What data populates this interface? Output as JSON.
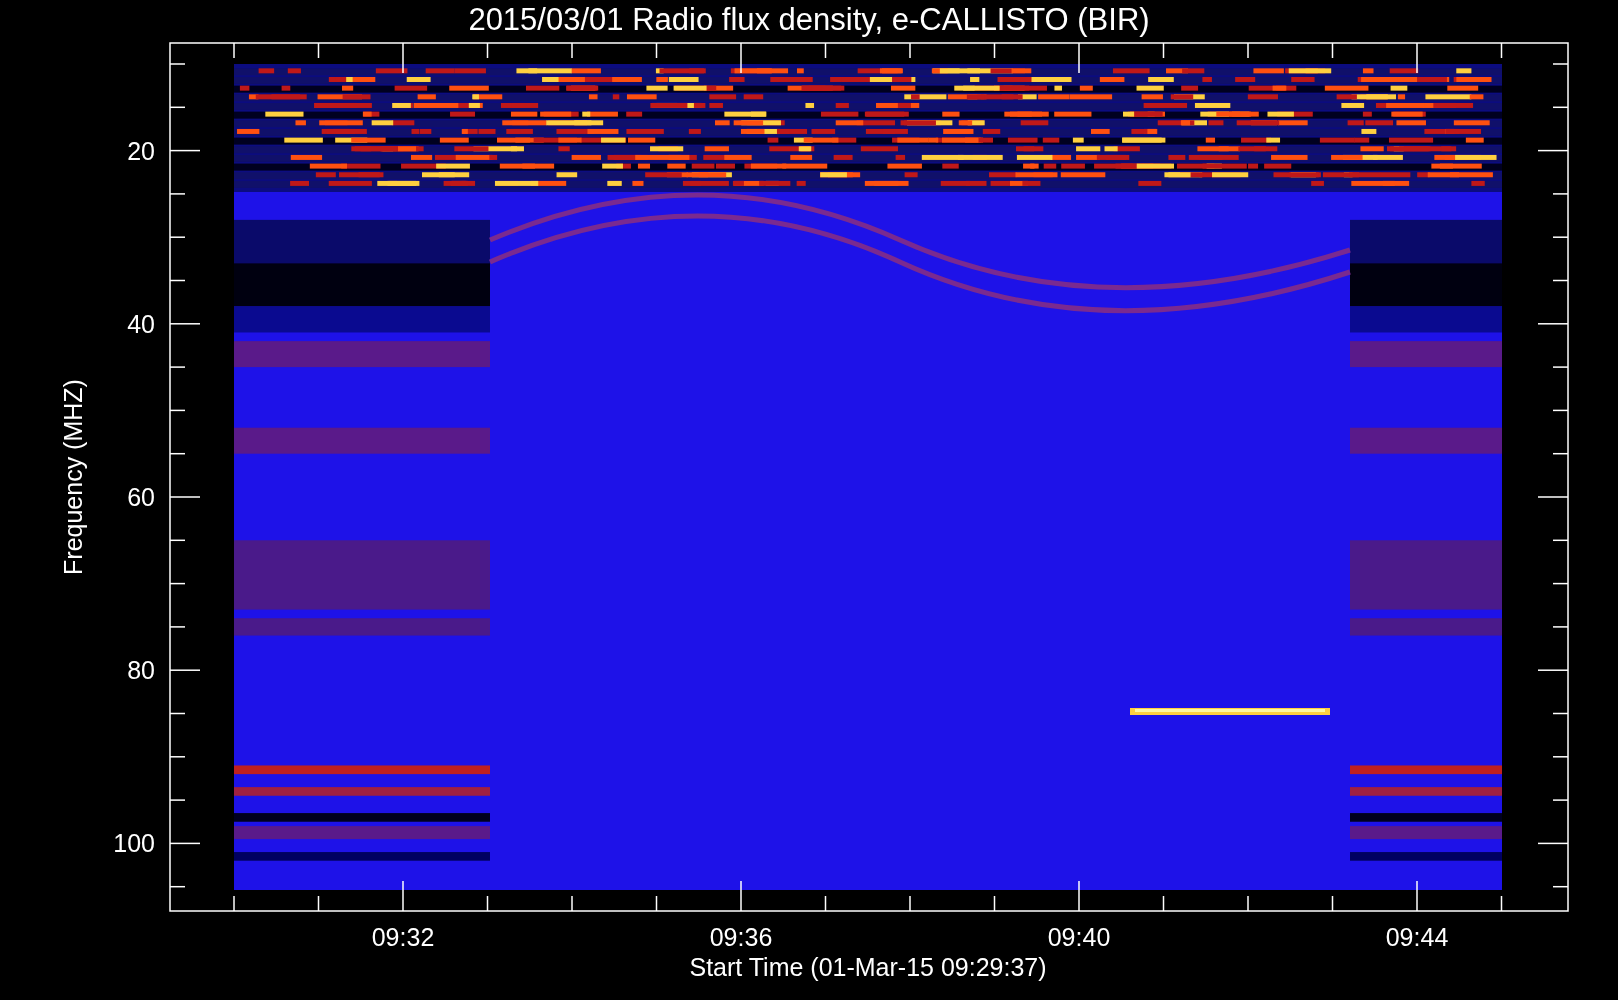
{
  "chart": {
    "title": "2015/03/01  Radio flux density, e-CALLISTO (BIR)",
    "y_axis": {
      "label": "Frequency (MHZ)",
      "ticks": [
        "20",
        "40",
        "60",
        "80",
        "100"
      ]
    },
    "x_axis": {
      "label": "Start Time (01-Mar-15 09:29:37)",
      "ticks": [
        "09:32",
        "09:36",
        "09:40",
        "09:44"
      ]
    }
  }
}
